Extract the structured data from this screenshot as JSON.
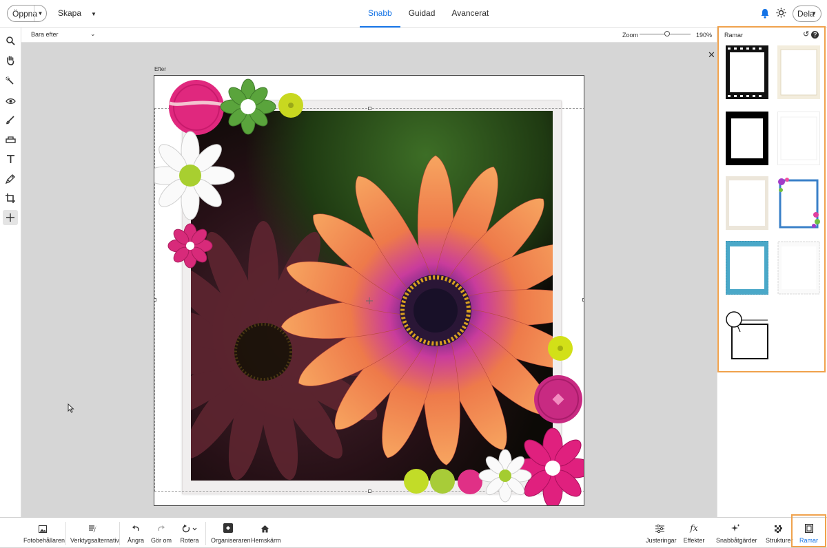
{
  "header": {
    "open_label": "Öppna",
    "create_label": "Skapa",
    "modes": [
      "Snabb",
      "Guidad",
      "Avancerat"
    ],
    "active_mode": "Snabb",
    "share_label": "Dela"
  },
  "options": {
    "view_select": "Bara efter",
    "zoom_label": "Zoom",
    "zoom_value": "190%"
  },
  "canvas": {
    "view_label": "Efter"
  },
  "panel": {
    "title": "Ramar",
    "frames": [
      "film-strip-frame",
      "vintage-paper-frame",
      "black-thick-frame",
      "thin-white-frame",
      "cream-photo-frame",
      "floral-blue-frame",
      "blue-gingham-frame",
      "deckled-edge-frame",
      "speech-bubble-frame"
    ]
  },
  "bottom": {
    "left": [
      "Fotobehållaren",
      "Verktygsalternativ"
    ],
    "actions": [
      "Ångra",
      "Gör om",
      "Rotera"
    ],
    "nav": [
      "Organiseraren",
      "Hemskärm"
    ],
    "right": [
      "Justeringar",
      "Effekter",
      "Snabbåtgärder",
      "Strukturer",
      "Ramar"
    ]
  },
  "colors": {
    "accent": "#1473e6",
    "highlight": "#f0a24c"
  }
}
